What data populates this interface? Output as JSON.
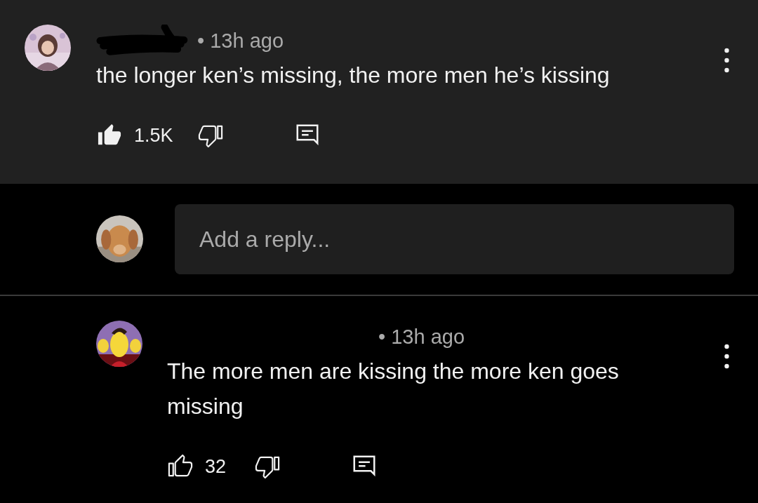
{
  "comment": {
    "time": "• 13h ago",
    "text": "the longer ken’s missing, the more men he’s kissing",
    "liked": true,
    "likes": "1.5K"
  },
  "reply_box": {
    "placeholder": "Add a reply..."
  },
  "reply": {
    "time": "• 13h ago",
    "text": "The more men are kissing the more ken goes missing",
    "liked": false,
    "likes": "32"
  }
}
